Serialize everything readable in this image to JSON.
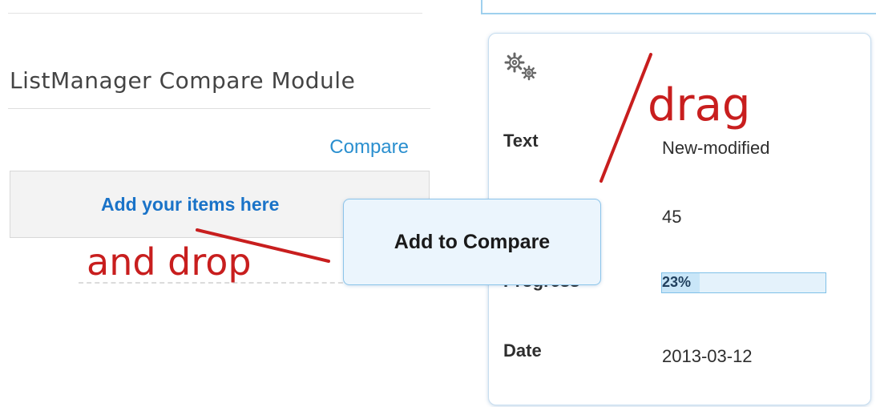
{
  "module": {
    "title": "ListManager Compare Module",
    "compare_link": "Compare",
    "drop_zone_label": "Add your items here"
  },
  "drag_helper": {
    "label": "Add to Compare"
  },
  "card": {
    "icon": "gears-icon",
    "rows": [
      {
        "label": "Text",
        "value": "New-modified"
      },
      {
        "label": "",
        "value": "45"
      },
      {
        "label": "Progress",
        "value": "23%",
        "progress_fraction": 0.23
      },
      {
        "label": "Date",
        "value": "2013-03-12"
      }
    ]
  },
  "annotations": {
    "drag": "drag",
    "drop": "and drop",
    "color": "#c81e1e"
  },
  "colors": {
    "link": "#2a8fcf",
    "drop_label": "#1a73c8",
    "card_border": "#c7ddef",
    "progress_border": "#7fc0e8"
  }
}
